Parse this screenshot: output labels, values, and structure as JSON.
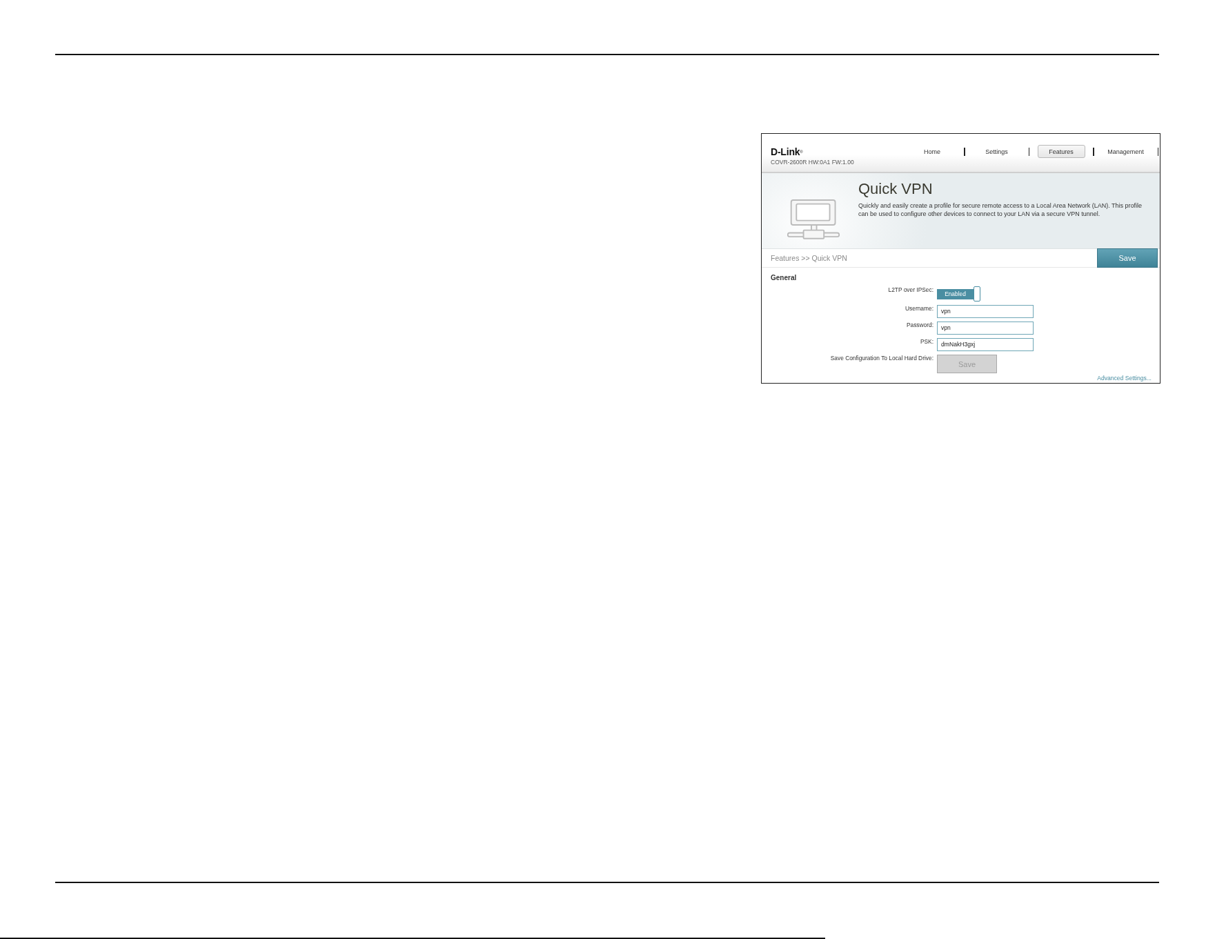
{
  "screenshot": {
    "header": {
      "logo": "D-Link$^{®}$",
      "model": "COVR-2600R HW:0A1 FW:1.00",
      "nav": [
        {
          "label": "Home",
          "selected": false
        },
        {
          "label": "Settings",
          "selected": false
        },
        {
          "label": "Features",
          "selected": true
        },
        {
          "label": "Management",
          "selected": false
        }
      ]
    },
    "banner": {
      "title": "Quick VPN",
      "description": "Quickly and easily create a profile for secure remote access to a Local Area Network (LAN). This profile can be used to configure other devices to connect to your LAN via a secure VPN tunnel."
    },
    "breadcrumb": "Features >> Quick VPN",
    "save_button": "Save",
    "section": {
      "title": "General",
      "fields": [
        {
          "kind": "toggle",
          "label": "L2TP over IPSec:",
          "value": "Enabled",
          "on": true
        },
        {
          "kind": "text",
          "label": "Username:",
          "value": "vpn"
        },
        {
          "kind": "text",
          "label": "Password:",
          "value": "vpn"
        },
        {
          "kind": "text",
          "label": "PSK:",
          "value": "dmNakH3gxj"
        },
        {
          "kind": "button",
          "label": "Save Configuration To Local Hard Drive:",
          "value": "Save",
          "disabled": true
        }
      ]
    },
    "advanced_link": "Advanced Settings..."
  }
}
